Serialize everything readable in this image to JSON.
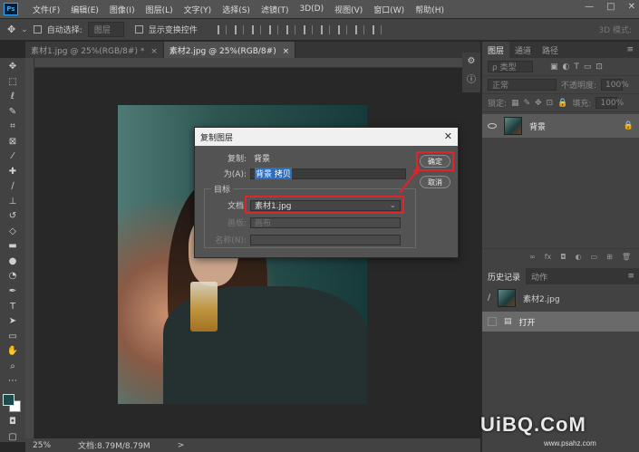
{
  "app": {
    "logo": "Ps",
    "menus": [
      "文件(F)",
      "编辑(E)",
      "图像(I)",
      "图层(L)",
      "文字(Y)",
      "选择(S)",
      "滤镜(T)",
      "3D(D)",
      "视图(V)",
      "窗口(W)",
      "帮助(H)"
    ],
    "window_controls": [
      "—",
      "□",
      "✕"
    ]
  },
  "options": {
    "auto_select_label": "自动选择:",
    "auto_select_value": "图层",
    "show_transform_label": "显示变换控件",
    "mode_3d": "3D 模式:"
  },
  "tabs": [
    {
      "label": "素材1.jpg @ 25%(RGB/8#) *",
      "close": "×"
    },
    {
      "label": "素材2.jpg @ 25%(RGB/8#)",
      "close": "×"
    }
  ],
  "dialog": {
    "title": "复制图层",
    "close": "✕",
    "copy_label": "复制:",
    "copy_value": "背景",
    "as_label": "为(A):",
    "as_value": "背景 拷贝",
    "target_label": "目标",
    "doc_label": "文档:",
    "doc_value": "素材1.jpg",
    "artboard_label": "画板:",
    "artboard_value": "画布",
    "name_label": "名称(N):",
    "name_value": "",
    "ok_label": "确定",
    "cancel_label": "取消"
  },
  "layers_panel": {
    "tabs": [
      "图层",
      "通道",
      "路径"
    ],
    "kind_label": "ρ 类型",
    "blend_mode": "正常",
    "opacity_label": "不透明度:",
    "opacity_value": "100%",
    "lock_label": "锁定:",
    "fill_label": "填充:",
    "fill_value": "100%",
    "layer_name": "背景",
    "footer_icons": [
      "∞",
      "fx",
      "◘",
      "◐",
      "▭",
      "⊞",
      "🗑"
    ]
  },
  "history_panel": {
    "tabs": [
      "历史记录",
      "动作"
    ],
    "snapshot": "素材2.jpg",
    "step": "打开"
  },
  "status": {
    "zoom": "25%",
    "doc": "文档:8.79M/8.79M",
    "arrow": ">"
  },
  "watermark": {
    "main": "UiBQ.CoM",
    "sub": "www.psahz.com"
  }
}
